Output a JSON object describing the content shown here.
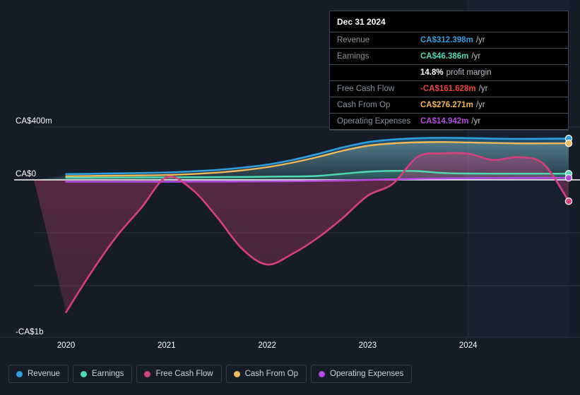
{
  "colors": {
    "background": "#151c27",
    "forecast_background": "#16202e",
    "grid": "#2b3341",
    "zero_line": "#ffffff",
    "axis_text": "#ffffff",
    "revenue": "#2f9fe0",
    "earnings": "#4fd9b4",
    "free_cash_flow": "#d6407f",
    "cash_from_op": "#f2b957",
    "operating_expenses": "#b44ae0",
    "tooltip_background": "#000000",
    "tooltip_border": "#3c4450",
    "tooltip_label": "#8d949c",
    "negative_value": "#f1433f",
    "profit_margin": "#ffffff"
  },
  "tooltip": {
    "date": "Dec 31 2024",
    "rows": [
      {
        "label": "Revenue",
        "value": "CA$312.398m",
        "unit": "/yr",
        "color": "#2f9fe0"
      },
      {
        "label": "Earnings",
        "value": "CA$46.386m",
        "unit": "/yr",
        "color": "#4fd9b4"
      },
      {
        "label": "",
        "value": "14.8%",
        "unit": "profit margin",
        "color": "#ffffff"
      },
      {
        "label": "Free Cash Flow",
        "value": "-CA$161.628m",
        "unit": "/yr",
        "color": "#f1433f"
      },
      {
        "label": "Cash From Op",
        "value": "CA$276.271m",
        "unit": "/yr",
        "color": "#f2b957"
      },
      {
        "label": "Operating Expenses",
        "value": "CA$14.942m",
        "unit": "/yr",
        "color": "#b44ae0"
      }
    ]
  },
  "legend": {
    "items": [
      {
        "label": "Revenue",
        "color": "#2f9fe0",
        "name": "legend-item-revenue"
      },
      {
        "label": "Earnings",
        "color": "#4fd9b4",
        "name": "legend-item-earnings"
      },
      {
        "label": "Free Cash Flow",
        "color": "#d6407f",
        "name": "legend-item-free-cash-flow"
      },
      {
        "label": "Cash From Op",
        "color": "#f2b957",
        "name": "legend-item-cash-from-op"
      },
      {
        "label": "Operating Expenses",
        "color": "#b44ae0",
        "name": "legend-item-operating-expenses"
      }
    ]
  },
  "chart_data": {
    "type": "line",
    "title": "",
    "xlabel": "",
    "ylabel": "",
    "currency": "CA$",
    "grid": true,
    "legend_position": "bottom",
    "xlim": [
      2019.68,
      2025.0
    ],
    "ylim": [
      -1000,
      400
    ],
    "y_ticks": [
      400,
      0,
      -1000
    ],
    "y_tick_labels": [
      "CA$400m",
      "CA$0",
      "-CA$1b"
    ],
    "y_gridlines": [
      400,
      0,
      -400,
      -800
    ],
    "x_ticks": [
      2020,
      2021,
      2022,
      2023,
      2024
    ],
    "x_tick_labels": [
      "2020",
      "2021",
      "2022",
      "2023",
      "2024"
    ],
    "forecast_start": 2024.0,
    "series": [
      {
        "name": "Revenue",
        "color": "#2f9fe0",
        "x": [
          2020.0,
          2020.25,
          2020.5,
          2020.75,
          2021.0,
          2021.25,
          2021.5,
          2021.75,
          2022.0,
          2022.25,
          2022.5,
          2022.75,
          2023.0,
          2023.25,
          2023.5,
          2023.75,
          2024.0,
          2024.25,
          2024.5,
          2024.75,
          2025.0
        ],
        "values": [
          44,
          46,
          49,
          52,
          56,
          64,
          75,
          92,
          115,
          150,
          195,
          245,
          285,
          305,
          315,
          318,
          316,
          312,
          310,
          311,
          312.398
        ]
      },
      {
        "name": "Earnings",
        "color": "#4fd9b4",
        "x": [
          2020.0,
          2020.25,
          2020.5,
          2020.75,
          2021.0,
          2021.25,
          2021.5,
          2021.75,
          2022.0,
          2022.25,
          2022.5,
          2022.75,
          2023.0,
          2023.25,
          2023.5,
          2023.75,
          2024.0,
          2024.25,
          2024.5,
          2024.75,
          2025.0
        ],
        "values": [
          16,
          16,
          17,
          18,
          19,
          20,
          21,
          22,
          24,
          26,
          30,
          46,
          62,
          68,
          66,
          52,
          48,
          47,
          47,
          47,
          46.386
        ]
      },
      {
        "name": "Free Cash Flow",
        "color": "#d6407f",
        "x": [
          2020.0,
          2020.25,
          2020.5,
          2020.75,
          2021.0,
          2021.25,
          2021.5,
          2021.75,
          2022.0,
          2022.25,
          2022.5,
          2022.75,
          2023.0,
          2023.25,
          2023.5,
          2023.75,
          2024.0,
          2024.25,
          2024.5,
          2024.75,
          2025.0
        ],
        "values": [
          -1000,
          -700,
          -430,
          -210,
          20,
          -70,
          -280,
          -520,
          -640,
          -560,
          -440,
          -290,
          -120,
          -30,
          175,
          200,
          198,
          150,
          172,
          120,
          -161.628
        ]
      },
      {
        "name": "Cash From Op",
        "color": "#f2b957",
        "x": [
          2020.0,
          2020.25,
          2020.5,
          2020.75,
          2021.0,
          2021.25,
          2021.5,
          2021.75,
          2022.0,
          2022.25,
          2022.5,
          2022.75,
          2023.0,
          2023.25,
          2023.5,
          2023.75,
          2024.0,
          2024.25,
          2024.5,
          2024.75,
          2025.0
        ],
        "values": [
          28,
          30,
          32,
          34,
          37,
          44,
          55,
          72,
          96,
          130,
          172,
          220,
          258,
          276,
          284,
          286,
          283,
          279,
          276,
          276,
          276.271
        ]
      },
      {
        "name": "Operating Expenses",
        "color": "#b44ae0",
        "x": [
          2020.0,
          2020.25,
          2020.5,
          2020.75,
          2021.0,
          2021.25,
          2021.5,
          2021.75,
          2022.0,
          2022.25,
          2022.5,
          2022.75,
          2023.0,
          2023.25,
          2023.5,
          2023.75,
          2024.0,
          2024.25,
          2024.5,
          2024.75,
          2025.0
        ],
        "values": [
          -14,
          -14,
          -14,
          -14,
          -14,
          -13,
          -13,
          -12,
          -11,
          -10,
          -8,
          -5,
          0,
          4,
          8,
          11,
          13,
          14,
          14.5,
          14.8,
          14.942
        ]
      }
    ],
    "endpoint_markers": [
      {
        "series": "Revenue",
        "value": 312.398,
        "color": "#2f9fe0"
      },
      {
        "series": "Cash From Op",
        "value": 276.271,
        "color": "#f2b957"
      },
      {
        "series": "Earnings",
        "value": 46.386,
        "color": "#4fd9b4"
      },
      {
        "series": "Operating Expenses",
        "value": 14.942,
        "color": "#b44ae0"
      },
      {
        "series": "Free Cash Flow",
        "value": -161.628,
        "color": "#d6407f"
      }
    ]
  }
}
